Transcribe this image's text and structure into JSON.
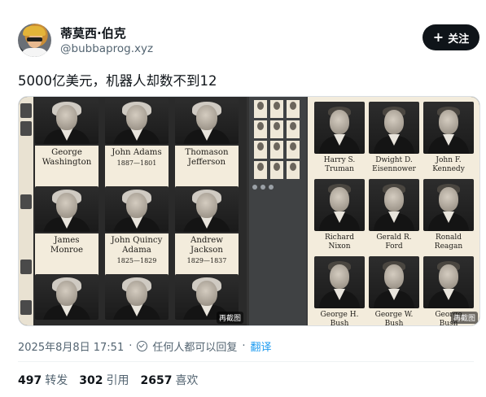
{
  "author": {
    "display_name": "蒂莫西·伯克",
    "handle": "@bubbaprog.xyz"
  },
  "follow_button": {
    "icon": "plus-icon",
    "label": "关注"
  },
  "tweet": {
    "text": "5000亿美元，机器人却数不到12",
    "timestamp": "2025年8月8日 17:51",
    "reply_setting": "任何人都可以回复",
    "translate_label": "翻译",
    "separator": "·"
  },
  "media": {
    "image1": {
      "cells": [
        {
          "name": "George\nWashington",
          "years": ""
        },
        {
          "name": "John Adams",
          "years": "1887—1801"
        },
        {
          "name": "Thomason\nJefferson",
          "years": ""
        },
        {
          "name": "James\nMonroe",
          "years": ""
        },
        {
          "name": "John Quincy\nAdama",
          "years": "1825—1829"
        },
        {
          "name": "Andrew\nJackson",
          "years": "1829—1837"
        },
        {
          "name": "",
          "years": ""
        },
        {
          "name": "",
          "years": ""
        },
        {
          "name": "",
          "years": ""
        }
      ],
      "watermark": "再截图"
    },
    "image2": {
      "cells": [
        {
          "name": "Harry S.\nTruman"
        },
        {
          "name": "Dwight D.\nEisennower"
        },
        {
          "name": "John F.\nKennedy"
        },
        {
          "name": "Richard\nNixon"
        },
        {
          "name": "Gerald R.\nFord"
        },
        {
          "name": "Ronald\nReagan"
        },
        {
          "name": "George H.\nBush"
        },
        {
          "name": "George W.\nBush"
        },
        {
          "name": "George\nBush"
        }
      ],
      "watermark": "再截图"
    }
  },
  "stats": [
    {
      "count": "497",
      "label": "转发"
    },
    {
      "count": "302",
      "label": "引用"
    },
    {
      "count": "2657",
      "label": "喜欢"
    }
  ]
}
